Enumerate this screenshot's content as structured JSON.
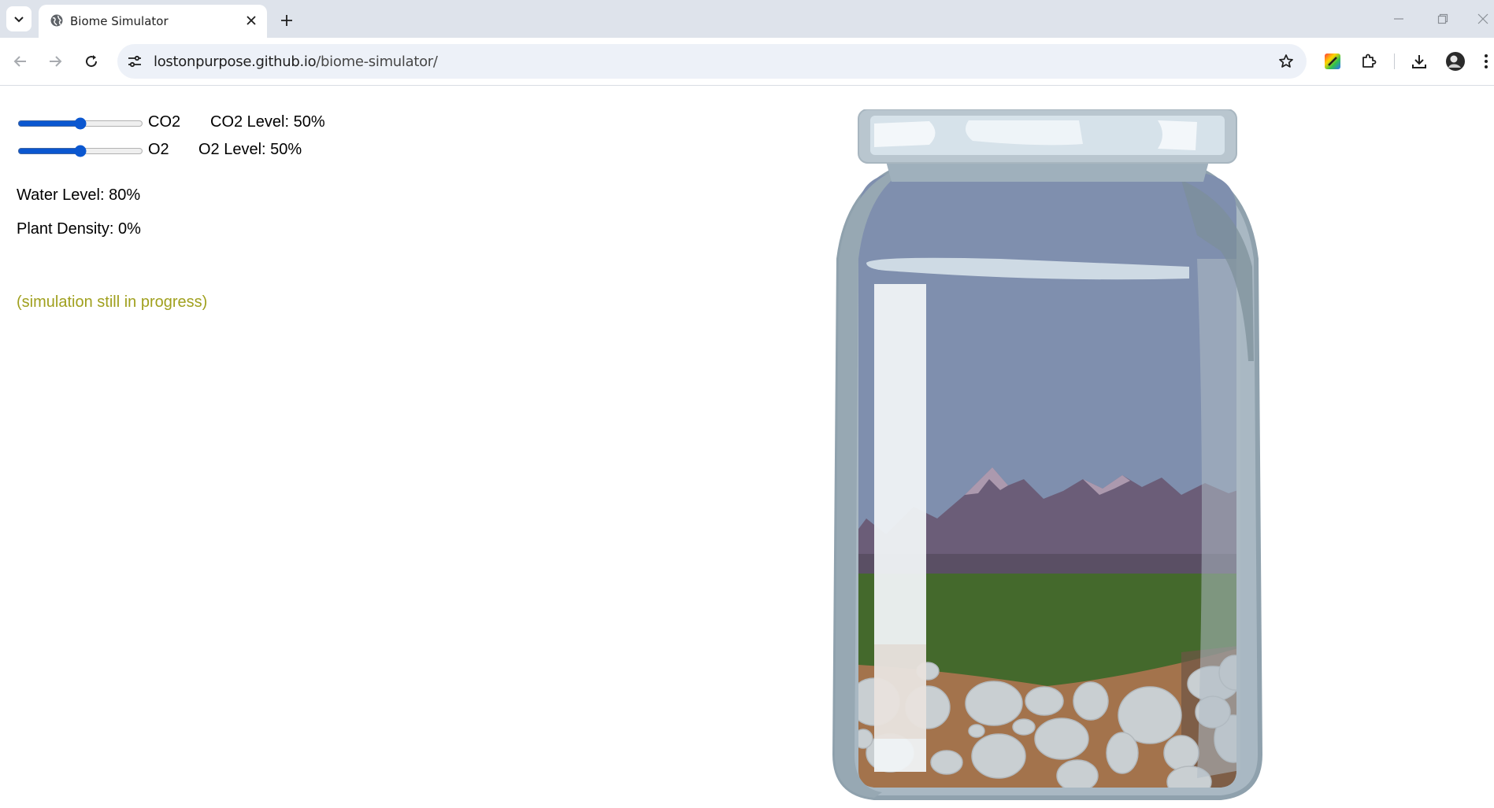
{
  "browser": {
    "tab": {
      "title": "Biome Simulator"
    },
    "address_bar": {
      "host": "lostonpurpose.github.io",
      "path": "/biome-simulator/"
    }
  },
  "controls": {
    "co2": {
      "slider_label": "CO2",
      "level_text": "CO2 Level: 50%",
      "value": 50,
      "min": 0,
      "max": 100
    },
    "o2": {
      "slider_label": "O2",
      "level_text": "O2 Level: 50%",
      "value": 50,
      "min": 0,
      "max": 100
    }
  },
  "stats": {
    "water_level": "Water Level: 80%",
    "plant_density": "Plant Density: 0%"
  },
  "status_note": "(simulation still in progress)",
  "colors": {
    "accent": "#0b57d0",
    "note": "#a0a01e",
    "sky": "#7f8fae",
    "grass": "#44692c",
    "soil": "#a3734c"
  },
  "icons": [
    "tab-list-icon",
    "globe-icon",
    "close-icon",
    "plus-icon",
    "minimize-icon",
    "restore-icon",
    "window-close-icon",
    "back-arrow-icon",
    "forward-arrow-icon",
    "reload-icon",
    "site-info-icon",
    "star-icon",
    "color-extension-icon",
    "puzzle-icon",
    "download-icon",
    "profile-avatar-icon",
    "more-icon"
  ]
}
